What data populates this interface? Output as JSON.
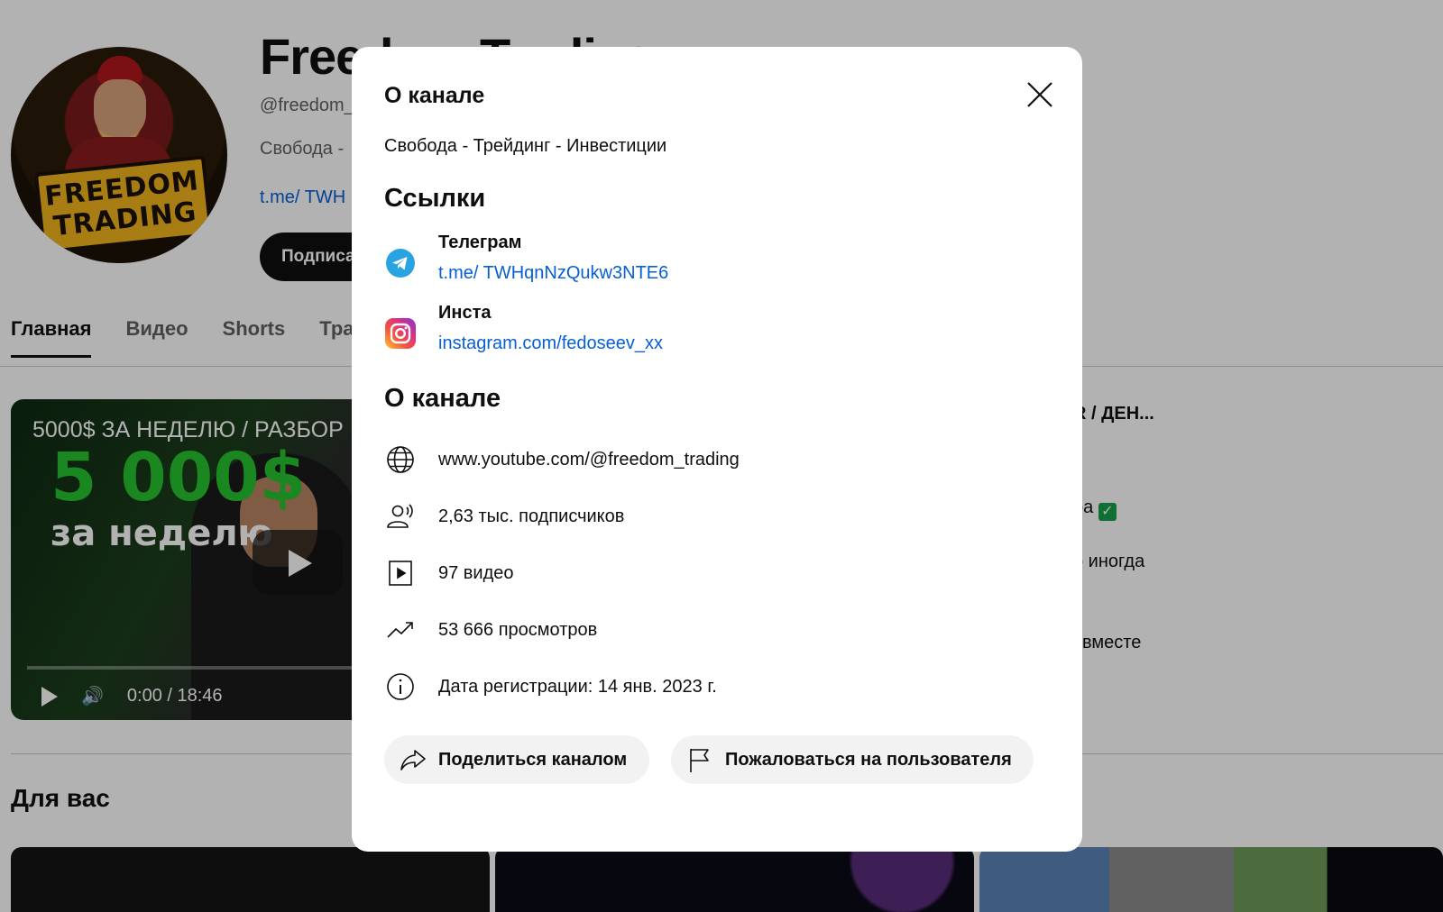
{
  "background": {
    "channel_title": "Freedom Trading",
    "handle": "@freedom_",
    "description": "Свобода - ",
    "link": "t.me/ TWH",
    "subscribe_label": "Подписа",
    "avatar_text_1": "FREEDOM",
    "avatar_text_2": "TRADING",
    "tabs": [
      {
        "label": "Главная",
        "active": true
      },
      {
        "label": "Видео"
      },
      {
        "label": "Shorts"
      },
      {
        "label": "Тра"
      }
    ],
    "featured_video": {
      "title": "5000$ ЗА НЕДЕЛЮ / РАЗБОР",
      "thumb_big_text": "5 000$",
      "thumb_sub_text": "за неделю",
      "time": "0:00 / 18:46"
    },
    "side_snippets": [
      "R / ДЕН...",
      "ра",
      "о иногда",
      "і вместе"
    ],
    "for_you_heading": "Для вас"
  },
  "modal": {
    "title": "О канале",
    "tagline": "Свобода - Трейдинг - Инвестиции",
    "links_heading": "Ссылки",
    "links": [
      {
        "name": "Телеграм",
        "url": "t.me/ TWHqnNzQukw3NTE6",
        "icon": "telegram-icon"
      },
      {
        "name": "Инста",
        "url": "instagram.com/fedoseev_xx",
        "icon": "instagram-icon"
      }
    ],
    "about_heading": "О канале",
    "details": {
      "channel_url": "www.youtube.com/@freedom_trading",
      "subscribers": "2,63 тыс. подписчиков",
      "videos": "97 видео",
      "views": "53 666 просмотров",
      "joined": "Дата регистрации: 14 янв. 2023 г."
    },
    "share_label": "Поделиться каналом",
    "report_label": "Пожаловаться на пользователя"
  },
  "colors": {
    "link": "#065fd4",
    "overlay": "rgba(0,0,0,0.3)",
    "telegram": "#2aa3e1",
    "button_bg": "#f2f2f2"
  }
}
